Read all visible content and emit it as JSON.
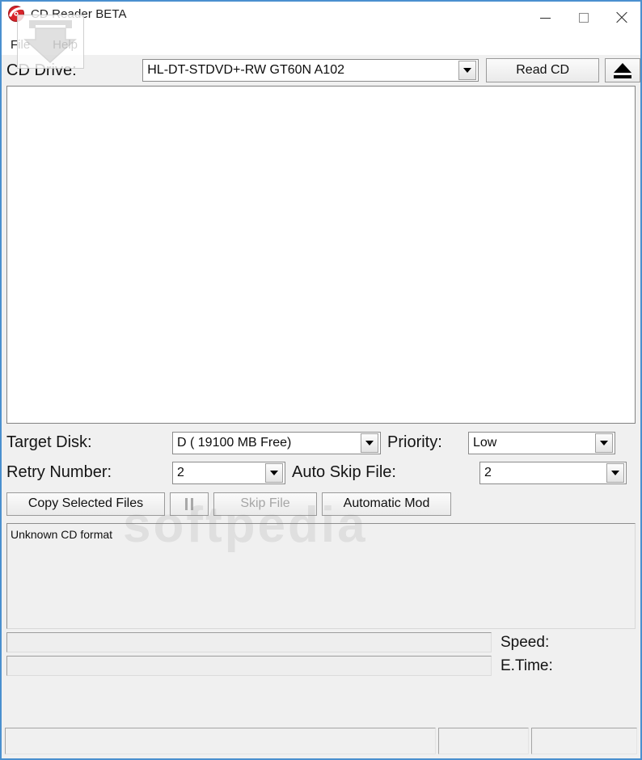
{
  "window": {
    "title": "CD Reader BETA",
    "app_icon": "cd-disc-icon",
    "accent_border_color": "#4a90cf",
    "controls": {
      "minimize": "minimize-icon",
      "maximize": "maximize-icon",
      "close": "close-icon"
    }
  },
  "menubar": {
    "items": [
      {
        "label": "File"
      },
      {
        "label": "Help"
      }
    ]
  },
  "drive": {
    "label": "CD Drive:",
    "value": "HL-DT-STDVD+-RW GT60N  A102",
    "placeholder": "",
    "read_button": "Read CD",
    "eject_icon": "eject-icon"
  },
  "file_list": {
    "items": []
  },
  "options": {
    "target_disk": {
      "label": "Target Disk:",
      "value": "D ( 19100 MB Free)"
    },
    "priority": {
      "label": "Priority:",
      "value": "Low"
    },
    "retry_number": {
      "label": "Retry Number:",
      "value": "2"
    },
    "auto_skip_file": {
      "label": "Auto Skip File:",
      "value": "2"
    }
  },
  "actions": {
    "copy_selected": "Copy Selected Files",
    "pause_icon": "pause-icon",
    "skip_file": "Skip File",
    "automatic_mod": "Automatic Mod"
  },
  "log": {
    "lines": [
      "Unknown CD format"
    ]
  },
  "progress": {
    "bar_file_percent": 0,
    "bar_total_percent": 0,
    "speed": {
      "label": "Speed:",
      "value": ""
    },
    "etime": {
      "label": "E.Time:",
      "value": ""
    }
  },
  "statusbar": {
    "panels": [
      "",
      "",
      ""
    ]
  },
  "watermark": {
    "text": "softpedia"
  }
}
